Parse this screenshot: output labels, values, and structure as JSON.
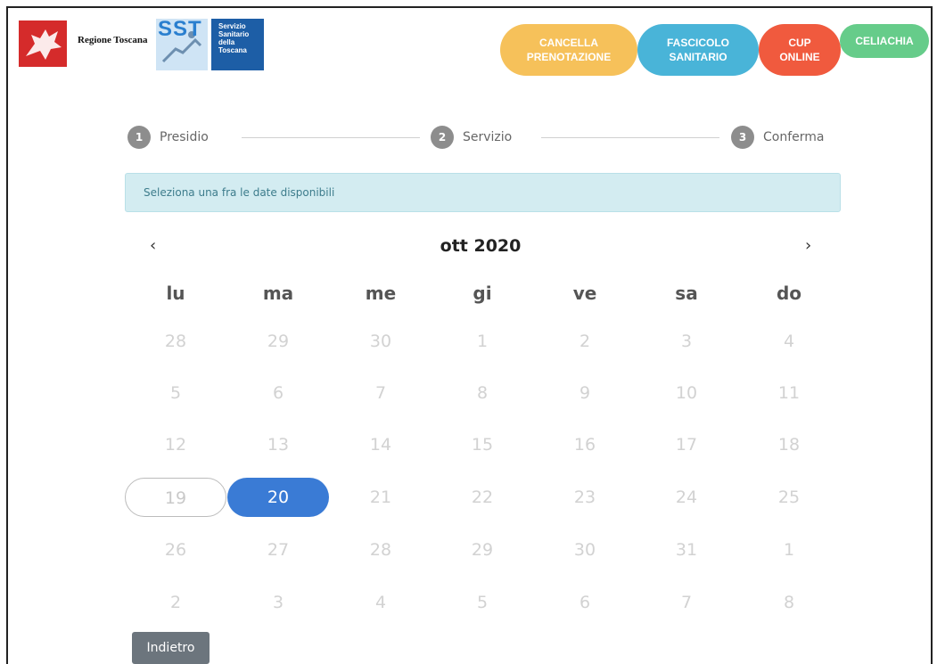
{
  "header": {
    "region_label": "Regione Toscana",
    "sst_logo_text": "SST",
    "sst_name": [
      "Servizio",
      "Sanitario",
      "della",
      "Toscana"
    ],
    "buttons": {
      "cancella": [
        "CANCELLA",
        "PRENOTAZIONE"
      ],
      "fascicolo": [
        "FASCICOLO",
        "SANITARIO"
      ],
      "cup": [
        "CUP",
        "ONLINE"
      ],
      "celiachia": "CELIACHIA"
    }
  },
  "steps": [
    {
      "num": "1",
      "label": "Presidio"
    },
    {
      "num": "2",
      "label": "Servizio"
    },
    {
      "num": "3",
      "label": "Conferma"
    }
  ],
  "alert": "Seleziona una fra le date disponibili",
  "calendar": {
    "month_label": "ott 2020",
    "prev_icon": "‹",
    "next_icon": "›",
    "weekdays": [
      "lu",
      "ma",
      "me",
      "gi",
      "ve",
      "sa",
      "do"
    ],
    "weeks": [
      [
        "28",
        "29",
        "30",
        "1",
        "2",
        "3",
        "4"
      ],
      [
        "5",
        "6",
        "7",
        "8",
        "9",
        "10",
        "11"
      ],
      [
        "12",
        "13",
        "14",
        "15",
        "16",
        "17",
        "18"
      ],
      [
        "19",
        "20",
        "21",
        "22",
        "23",
        "24",
        "25"
      ],
      [
        "26",
        "27",
        "28",
        "29",
        "30",
        "31",
        "1"
      ],
      [
        "2",
        "3",
        "4",
        "5",
        "6",
        "7",
        "8"
      ]
    ],
    "selected_day": "20",
    "outlined_day": "19"
  },
  "back_button": "Indietro",
  "colors": {
    "cancella": "#f6c15a",
    "fascicolo": "#49b4d8",
    "cup": "#f05a3e",
    "celiachia": "#66cc8a",
    "selected": "#3a7bd5"
  }
}
